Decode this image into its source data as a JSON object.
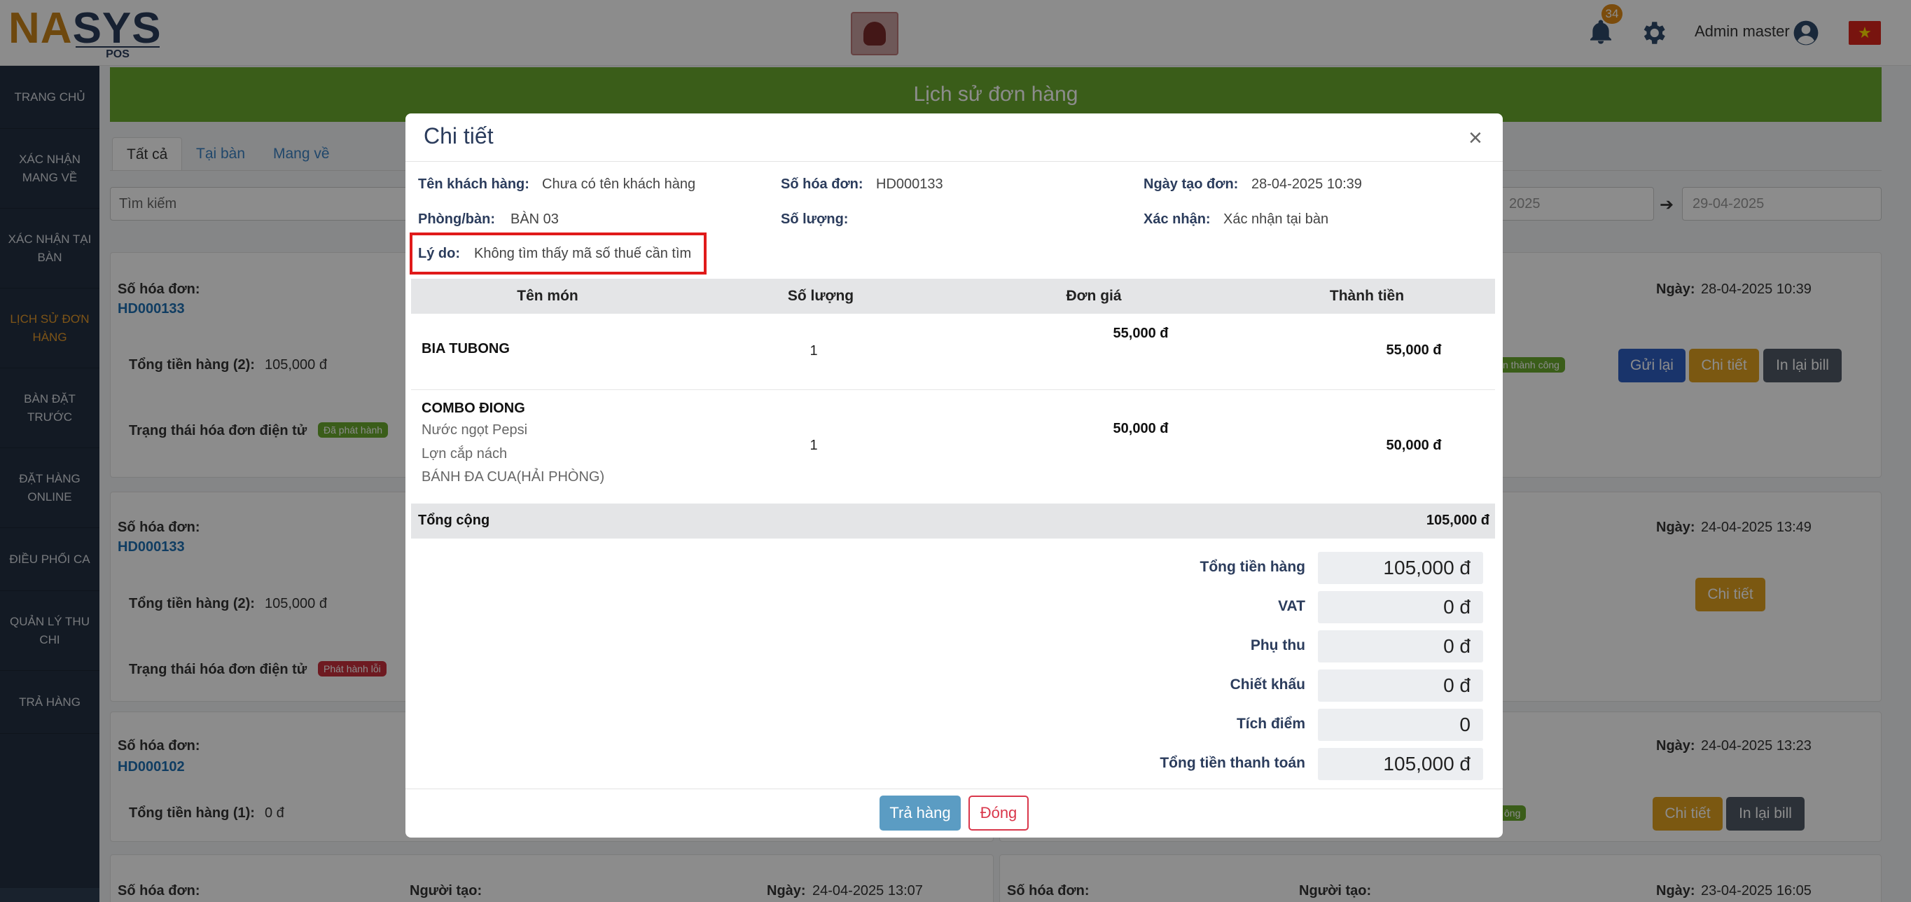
{
  "header": {
    "logo_main_a": "NA",
    "logo_main_b": "SYS",
    "logo_sub": "POS",
    "notification_count": "34",
    "user_name": "Admin master",
    "flag_star": "★"
  },
  "sidebar": {
    "items": [
      {
        "label": "TRANG CHỦ"
      },
      {
        "label": "XÁC NHẬN MANG VỀ"
      },
      {
        "label": "XÁC NHẬN TẠI BÀN"
      },
      {
        "label": "LỊCH SỬ ĐƠN HÀNG"
      },
      {
        "label": "BÀN ĐẶT TRƯỚC"
      },
      {
        "label": "ĐẶT HÀNG ONLINE"
      },
      {
        "label": "ĐIỀU PHỐI CA"
      },
      {
        "label": "QUẢN LÝ THU CHI"
      },
      {
        "label": "TRẢ HÀNG"
      }
    ]
  },
  "page": {
    "title": "Lịch sử đơn hàng",
    "tabs": [
      "Tất cả",
      "Tại bàn",
      "Mang về"
    ],
    "search_placeholder": "Tìm kiếm",
    "date_from": "2025",
    "date_to": "29-04-2025"
  },
  "orders": [
    {
      "inv_label": "Số hóa đơn:",
      "inv_no": "HD000133",
      "total_label": "Tổng tiền hàng (2):",
      "total": "105,000 đ",
      "einv_label": "Trạng thái hóa đơn điện tử",
      "einv_badge": "Đã phát hành",
      "date_label": "Ngày:",
      "date": "28-04-2025 10:39",
      "right_badge": "n thành công",
      "btn_resend": "Gửi lại",
      "btn_detail": "Chi tiết",
      "btn_print": "In lại bill"
    },
    {
      "inv_label": "Số hóa đơn:",
      "inv_no": "HD000133",
      "total_label": "Tổng tiền hàng (2):",
      "total": "105,000 đ",
      "einv_label": "Trạng thái hóa đơn điện tử",
      "einv_badge": "Phát hành lỗi",
      "date_label": "Ngày:",
      "date": "24-04-2025 13:49",
      "btn_detail": "Chi tiết"
    },
    {
      "inv_label": "Số hóa đơn:",
      "inv_no": "HD000102",
      "total_label": "Tổng tiền hàng (1):",
      "total": "0 đ",
      "date_label": "Ngày:",
      "date": "24-04-2025 13:23",
      "right_badge": "ông",
      "btn_detail": "Chi tiết",
      "btn_print": "In lại bill"
    },
    {
      "inv_label": "Số hóa đơn:",
      "creator_label": "Người tạo:",
      "date_label": "Ngày:",
      "date": "24-04-2025 13:07"
    },
    {
      "inv_label": "Số hóa đơn:",
      "creator_label": "Người tạo:",
      "date_label": "Ngày:",
      "date": "23-04-2025 16:05"
    }
  ],
  "modal": {
    "title": "Chi tiết",
    "close": "×",
    "customer_label": "Tên khách hàng:",
    "customer": "Chưa có tên khách hàng",
    "invoice_label": "Số hóa đơn:",
    "invoice": "HD000133",
    "created_label": "Ngày tạo đơn:",
    "created": "28-04-2025 10:39",
    "room_label": "Phòng/bàn:",
    "room": "BÀN 03",
    "qty_label": "Số lượng:",
    "confirm_label": "Xác nhận:",
    "confirm": "Xác nhận tại bàn",
    "reason_label": "Lý do:",
    "reason": "Không tìm thấy mã số thuế cần tìm",
    "columns": [
      "Tên món",
      "Số lượng",
      "Đơn giá",
      "Thành tiền"
    ],
    "items": [
      {
        "name": "BIA TUBONG",
        "subs": [],
        "qty": "1",
        "price": "55,000 đ",
        "amount": "55,000 đ"
      },
      {
        "name": "COMBO ĐIONG",
        "subs": [
          "Nước ngọt Pepsi",
          "Lợn cắp nách",
          "BÁNH ĐA CUA(HẢI PHÒNG)"
        ],
        "qty": "1",
        "price": "50,000 đ",
        "amount": "50,000 đ"
      }
    ],
    "grand_label": "Tổng cộng",
    "grand": "105,000 đ",
    "summary": [
      {
        "label": "Tổng tiền hàng",
        "value": "105,000 đ"
      },
      {
        "label": "VAT",
        "value": "0 đ"
      },
      {
        "label": "Phụ thu",
        "value": "0 đ"
      },
      {
        "label": "Chiết khấu",
        "value": "0 đ"
      },
      {
        "label": "Tích điểm",
        "value": "0"
      },
      {
        "label": "Tổng tiền thanh toán",
        "value": "105,000 đ"
      }
    ],
    "btn_return": "Trả hàng",
    "btn_close": "Đóng"
  }
}
